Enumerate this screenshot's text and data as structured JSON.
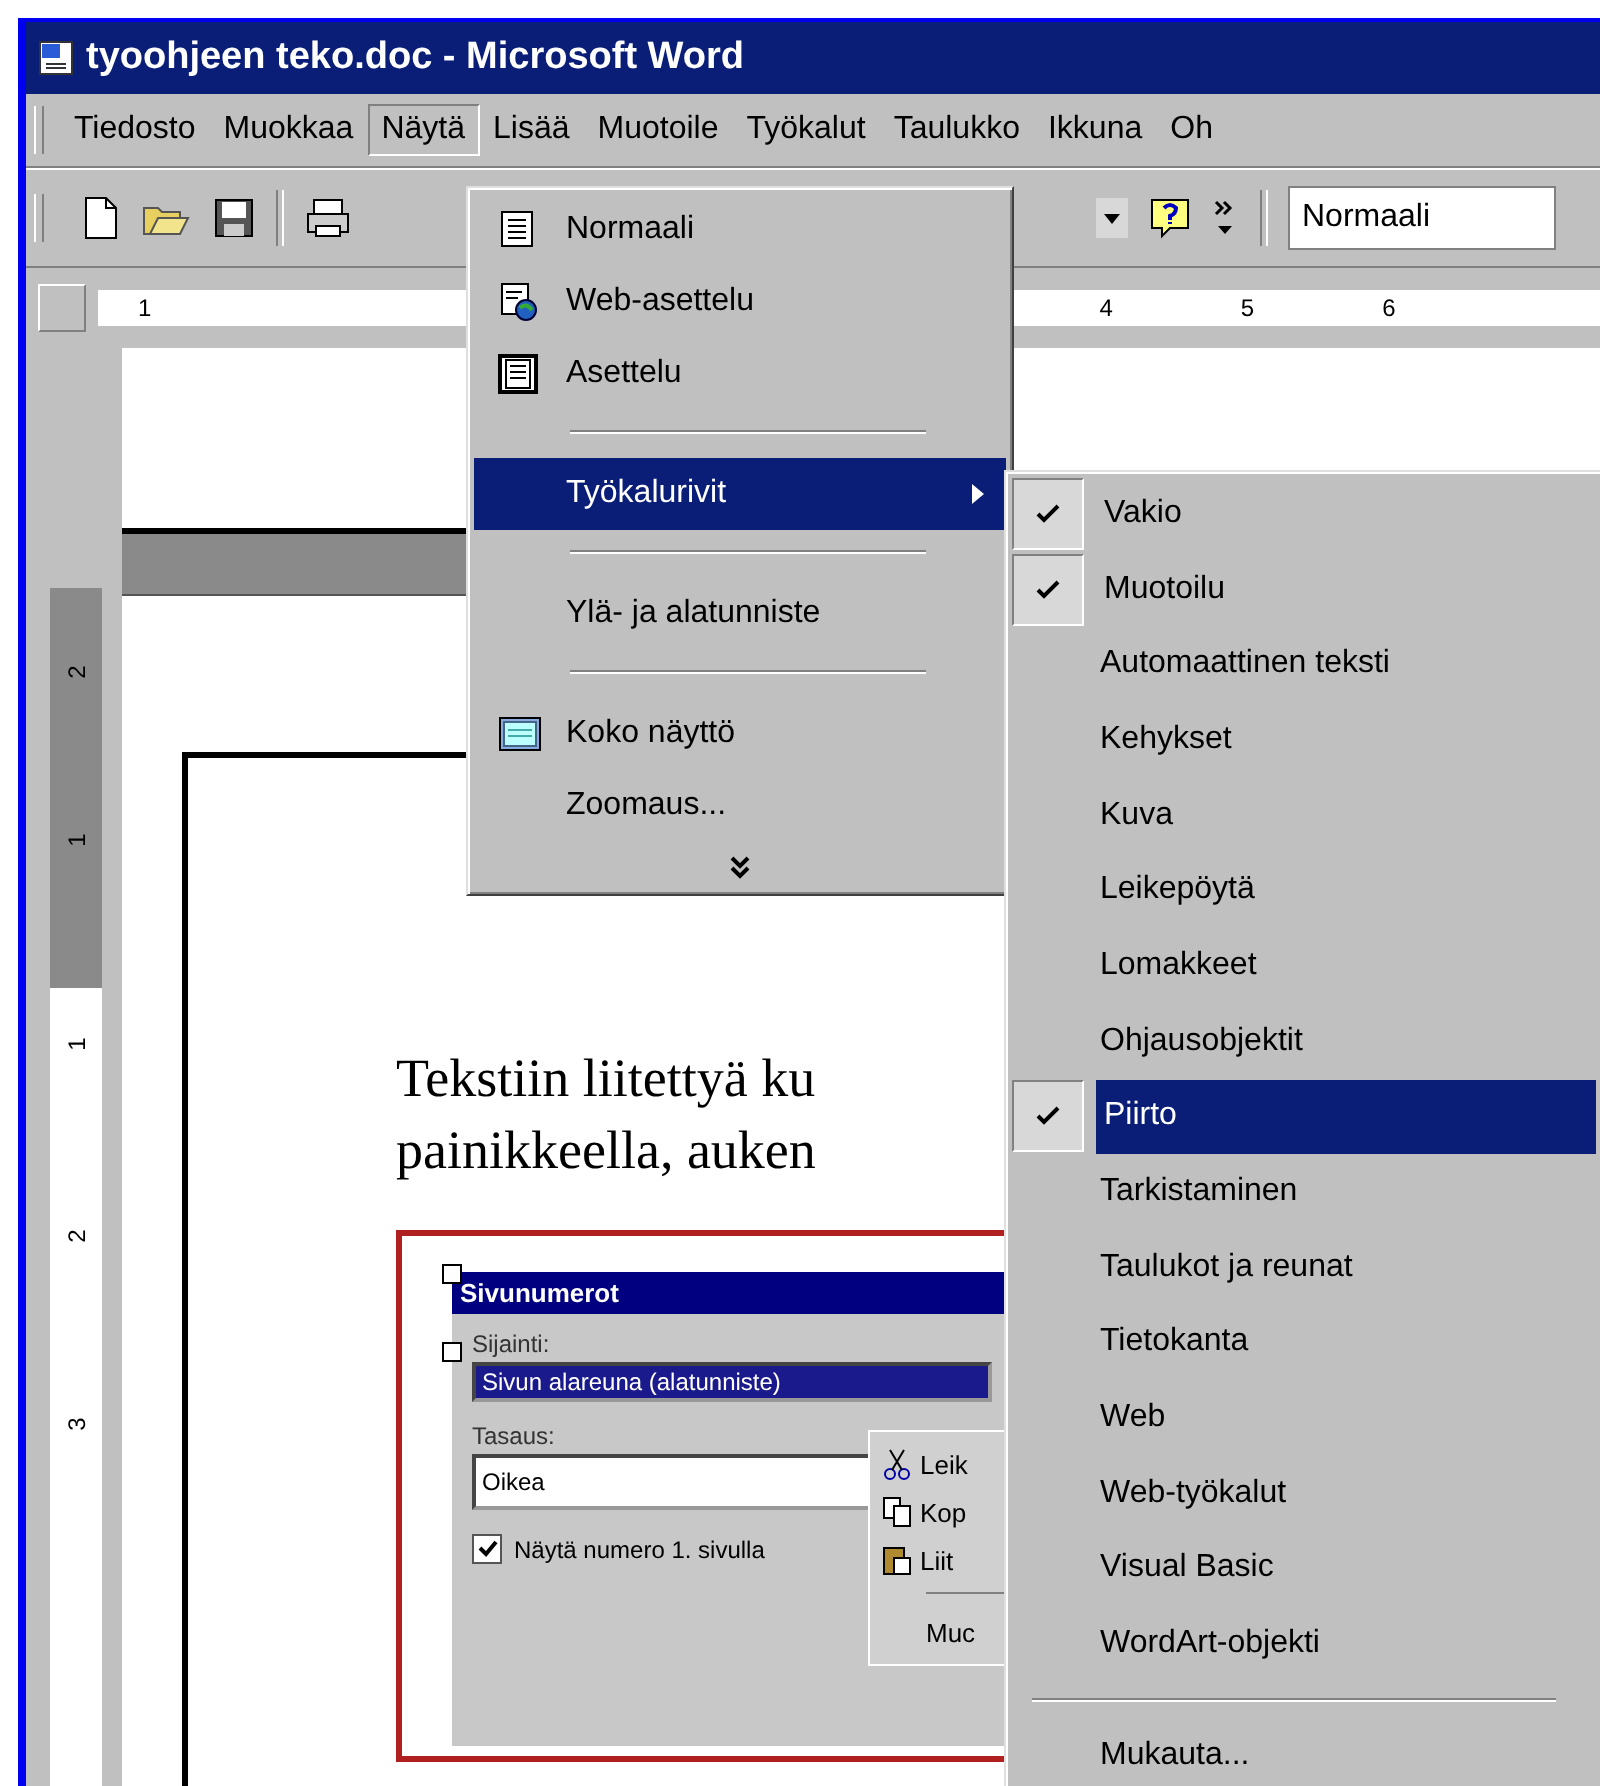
{
  "window": {
    "title": "tyoohjeen teko.doc - Microsoft Word"
  },
  "menu_bar": [
    {
      "label": "Tiedosto",
      "selected": false
    },
    {
      "label": "Muokkaa",
      "selected": false
    },
    {
      "label": "Näytä",
      "selected": true
    },
    {
      "label": "Lisää",
      "selected": false
    },
    {
      "label": "Muotoile",
      "selected": false
    },
    {
      "label": "Työkalut",
      "selected": false
    },
    {
      "label": "Taulukko",
      "selected": false
    },
    {
      "label": "Ikkuna",
      "selected": false
    },
    {
      "label": "Oh",
      "selected": false
    }
  ],
  "toolbar": {
    "style_box": "Normaali"
  },
  "ruler": {
    "labels": [
      "1",
      "4",
      "5",
      "6"
    ]
  },
  "vertical_ruler": {
    "labels": [
      "2",
      "1",
      "1",
      "2",
      "3"
    ]
  },
  "document": {
    "lines": [
      "Tekstiin liitettyä ku",
      "painikkeella, auken"
    ],
    "dialog": {
      "title": "Sivunumerot",
      "position_label": "Sijainti:",
      "position_value": "Sivun alareuna (alatunniste)",
      "alignment_label": "Tasaus:",
      "alignment_value": "Oikea",
      "checkbox": {
        "label": "Näytä numero 1. sivulla",
        "checked": true
      },
      "context_menu": [
        "Leik",
        "Kop",
        "Liit",
        "Muc"
      ]
    }
  },
  "view_menu": [
    {
      "kind": "item",
      "label": "Normaali",
      "selected": false
    },
    {
      "kind": "item",
      "label": "Web-asettelu",
      "selected": false
    },
    {
      "kind": "item",
      "label": "Asettelu",
      "selected": false
    },
    {
      "kind": "separator"
    },
    {
      "kind": "submenu",
      "label": "Työkalurivit",
      "selected": true
    },
    {
      "kind": "separator"
    },
    {
      "kind": "item",
      "label": "Ylä- ja alatunniste",
      "selected": false
    },
    {
      "kind": "separator"
    },
    {
      "kind": "item",
      "label": "Koko näyttö",
      "selected": false
    },
    {
      "kind": "item",
      "label": "Zoomaus...",
      "selected": false
    },
    {
      "kind": "expand"
    }
  ],
  "toolbars_menu": [
    {
      "kind": "item",
      "label": "Vakio",
      "checked": true,
      "selected": false
    },
    {
      "kind": "item",
      "label": "Muotoilu",
      "checked": true,
      "selected": false
    },
    {
      "kind": "item",
      "label": "Automaattinen teksti",
      "checked": false,
      "selected": false
    },
    {
      "kind": "item",
      "label": "Kehykset",
      "checked": false,
      "selected": false
    },
    {
      "kind": "item",
      "label": "Kuva",
      "checked": false,
      "selected": false
    },
    {
      "kind": "item",
      "label": "Leikepöytä",
      "checked": false,
      "selected": false
    },
    {
      "kind": "item",
      "label": "Lomakkeet",
      "checked": false,
      "selected": false
    },
    {
      "kind": "item",
      "label": "Ohjausobjektit",
      "checked": false,
      "selected": false
    },
    {
      "kind": "item",
      "label": "Piirto",
      "checked": true,
      "selected": true
    },
    {
      "kind": "item",
      "label": "Tarkistaminen",
      "checked": false,
      "selected": false
    },
    {
      "kind": "item",
      "label": "Taulukot ja reunat",
      "checked": false,
      "selected": false
    },
    {
      "kind": "item",
      "label": "Tietokanta",
      "checked": false,
      "selected": false
    },
    {
      "kind": "item",
      "label": "Web",
      "checked": false,
      "selected": false
    },
    {
      "kind": "item",
      "label": "Web-työkalut",
      "checked": false,
      "selected": false
    },
    {
      "kind": "item",
      "label": "Visual Basic",
      "checked": false,
      "selected": false
    },
    {
      "kind": "item",
      "label": "WordArt-objekti",
      "checked": false,
      "selected": false
    },
    {
      "kind": "separator"
    },
    {
      "kind": "item",
      "label": "Mukauta...",
      "checked": false,
      "selected": false
    }
  ]
}
